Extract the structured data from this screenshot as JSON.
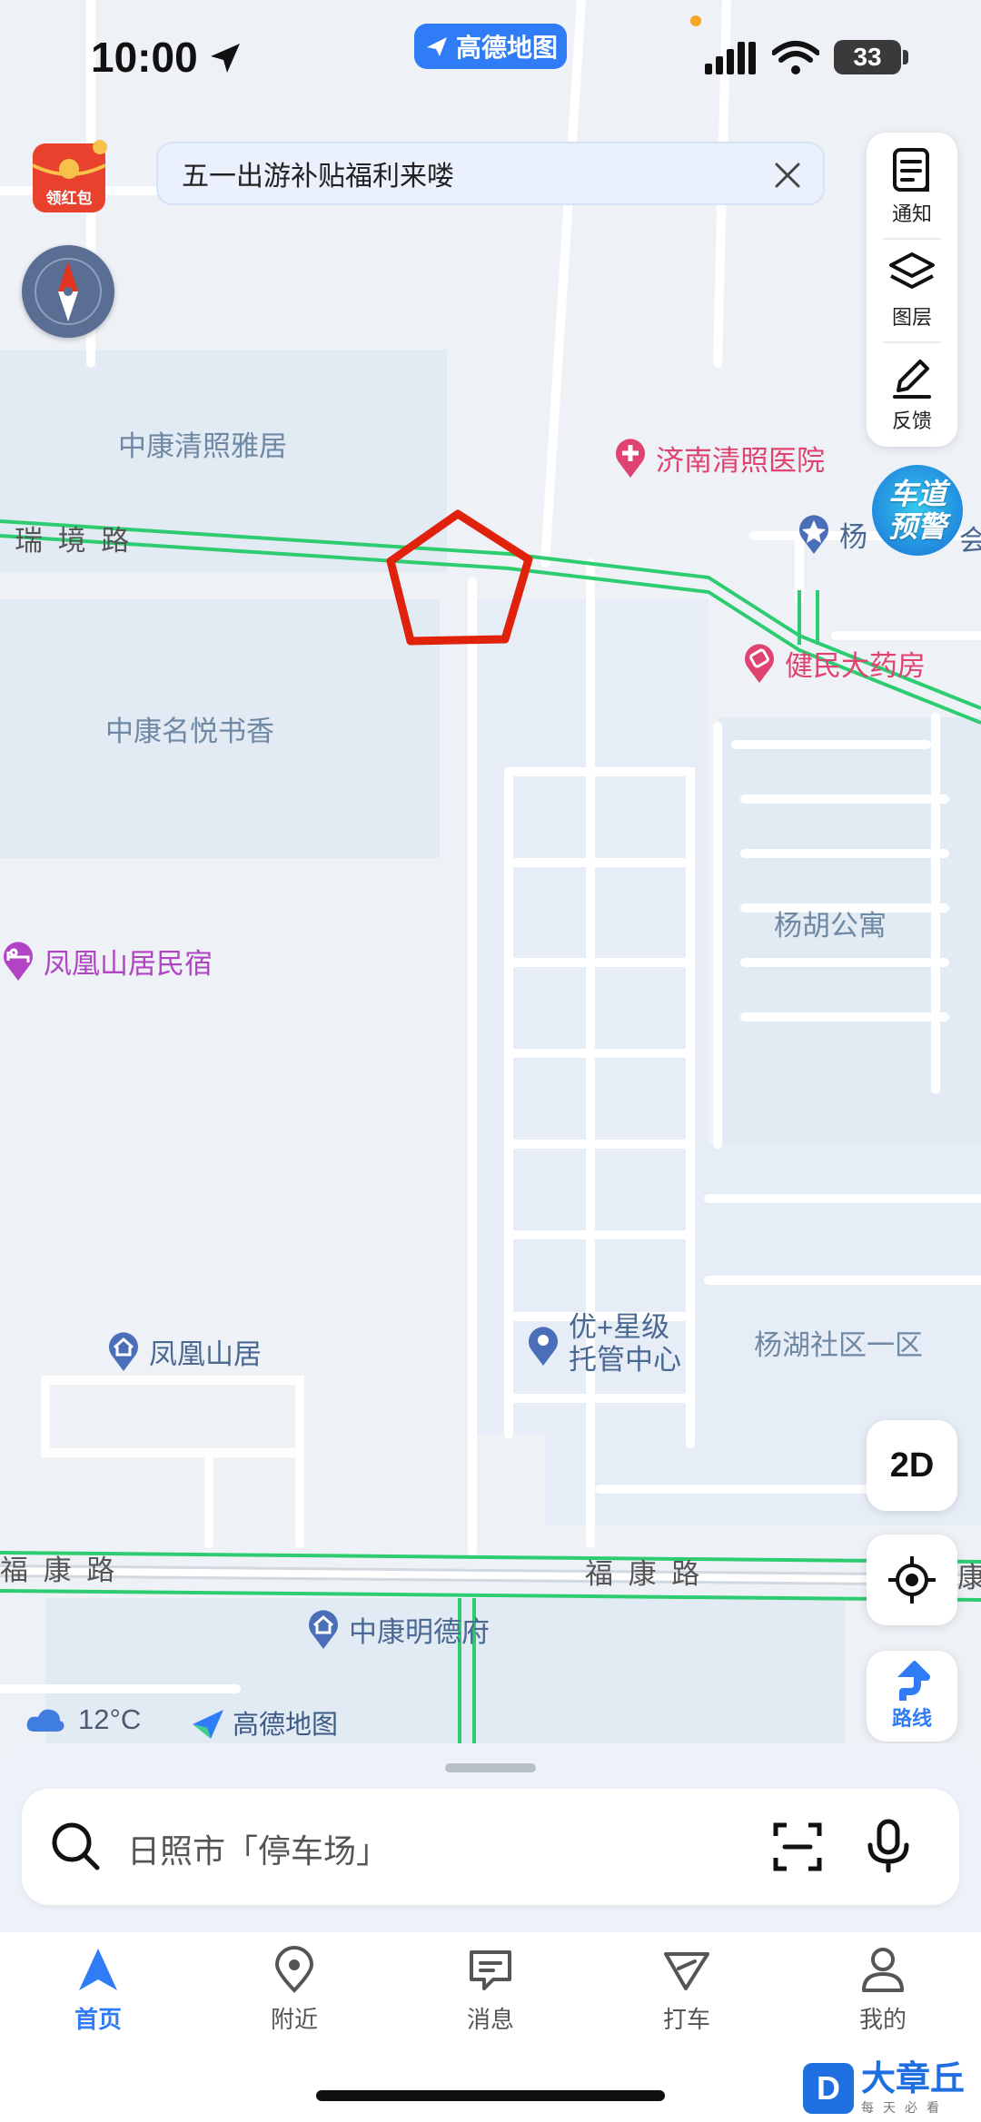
{
  "status_bar": {
    "time": "10:00",
    "app_pill": "高德地图",
    "battery": "33"
  },
  "colors": {
    "accent": "#2f7cf6",
    "road_green": "#2ecc71",
    "pentagon_red": "#e0220c",
    "poi_pink": "#e0436f",
    "poi_purple": "#b044c4"
  },
  "red_packet": {
    "label": "领红包"
  },
  "banner": {
    "text": "五一出游补贴福利来喽"
  },
  "tools": [
    {
      "label": "通知",
      "icon": "notice-icon"
    },
    {
      "label": "图层",
      "icon": "layers-icon"
    },
    {
      "label": "反馈",
      "icon": "feedback-icon"
    }
  ],
  "lane_badge": {
    "line1": "车道",
    "line2": "预警"
  },
  "map": {
    "areas": {
      "zhongkang_qingzhao": "中康清照雅居",
      "zhongkang_mingyue": "中康名悦书香",
      "yanghu_apartment": "杨胡公寓",
      "yanghu_community": "杨湖社区一区"
    },
    "roads": {
      "ruijing": "瑞 境 路",
      "fukang_left": "福 康 路",
      "fukang_mid": "福 康 路",
      "kang_edge": "康"
    },
    "pois": {
      "hospital": "济南清照医院",
      "yang_partial": "杨",
      "hui_partial": "会",
      "pharmacy": "健民大药房",
      "homestay": "凤凰山居民宿",
      "fenghuang": "凤凰山居",
      "daycare_line1": "优+星级",
      "daycare_line2": "托管中心",
      "mingde": "中康明德府"
    }
  },
  "map_buttons": {
    "mode": "2D",
    "route": "路线"
  },
  "weather": {
    "temp": "12°C"
  },
  "watermark": {
    "brand": "高德地图"
  },
  "search": {
    "placeholder": "日照市「停车场」"
  },
  "tabs": [
    {
      "label": "首页",
      "active": true
    },
    {
      "label": "附近",
      "active": false
    },
    {
      "label": "消息",
      "active": false
    },
    {
      "label": "打车",
      "active": false
    },
    {
      "label": "我的",
      "active": false
    }
  ],
  "corner_mark": {
    "logo": "D",
    "title": "大章丘",
    "sub": "每天必看"
  }
}
